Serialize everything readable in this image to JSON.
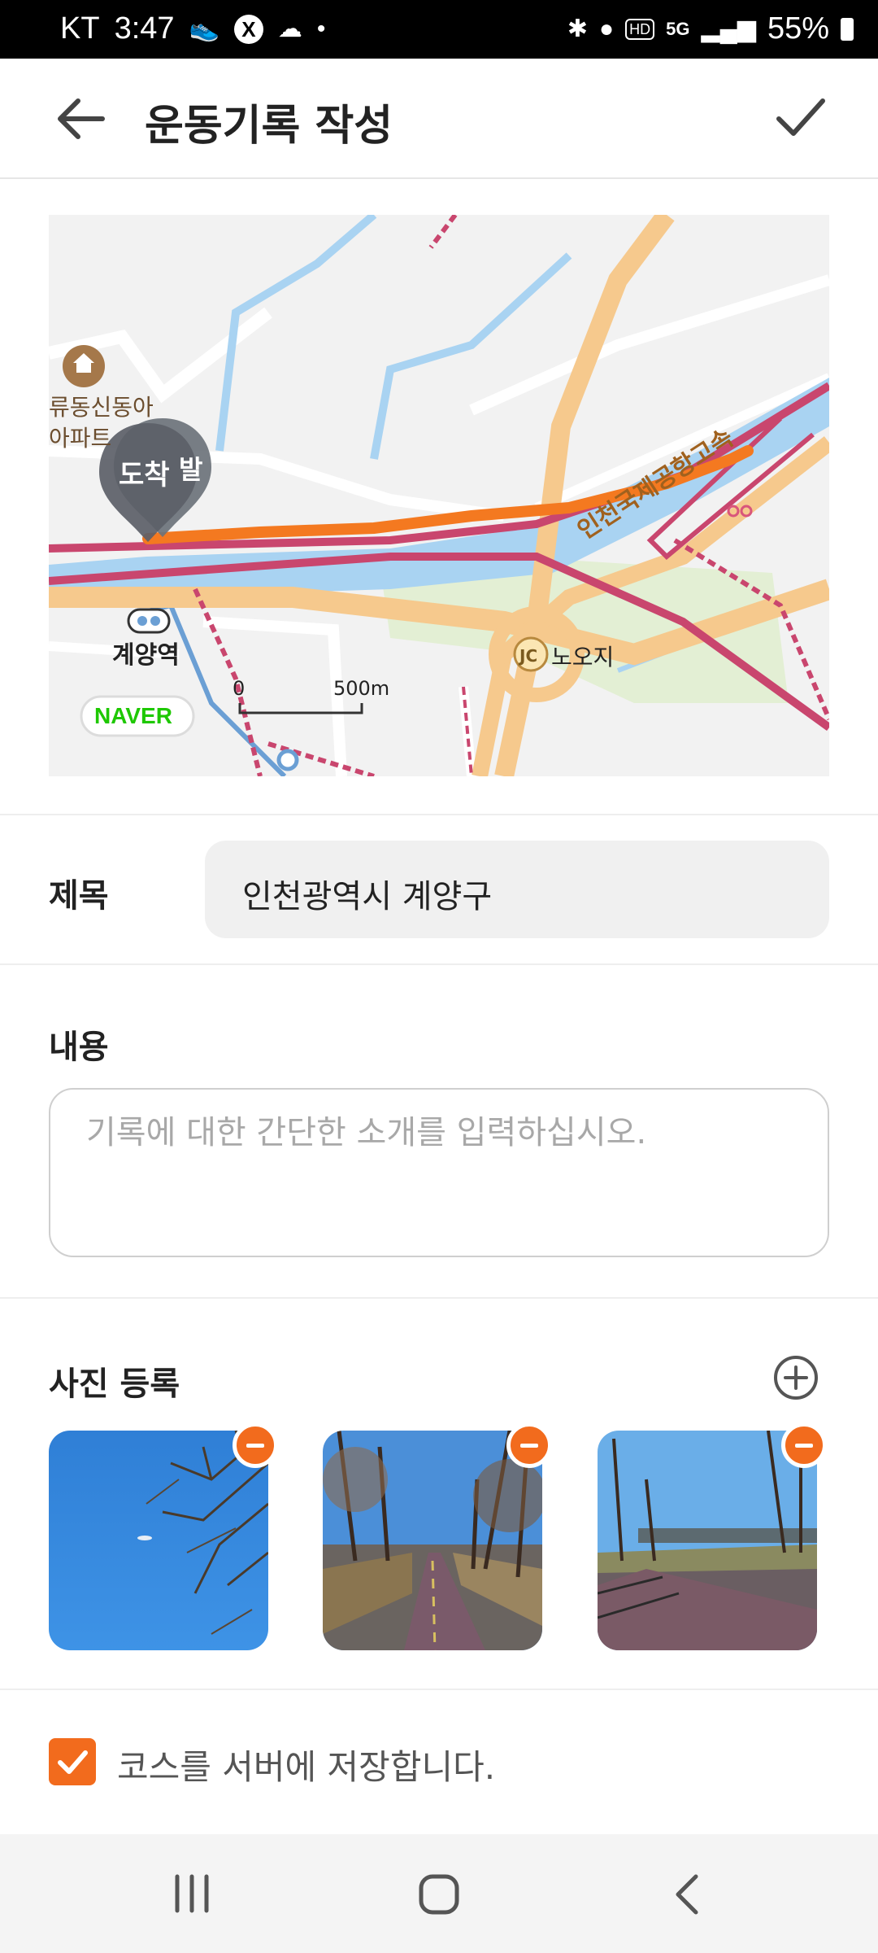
{
  "status_bar": {
    "carrier": "KT",
    "time": "3:47",
    "network": "5G",
    "battery": "55%"
  },
  "app_bar": {
    "title": "운동기록 작성",
    "back_icon": "arrow-left-icon",
    "confirm_icon": "check-icon"
  },
  "map": {
    "labels": {
      "apartment": "류동신동아\n아파트",
      "arrival_pin": "도착",
      "start_pin": "발",
      "station": "계양역",
      "brand": "NAVER",
      "scale_zero": "0",
      "scale_dist": "500m",
      "junction_badge": "JC",
      "junction_name": "노오지",
      "highway": "인천국제공항고속"
    },
    "colors": {
      "route": "#f47920",
      "water": "#a9d3f2",
      "road": "#f6c98d",
      "highway": "#c9466e",
      "park": "#e4efd5",
      "naver_green": "#1ec800"
    }
  },
  "form": {
    "title_label": "제목",
    "title_value": "인천광역시 계양구",
    "content_label": "내용",
    "content_placeholder": "기록에 대한 간단한 소개를 입력하십시오.",
    "photo_label": "사진 등록",
    "photos": [
      {
        "name": "photo-sky-branches"
      },
      {
        "name": "photo-tree-lined-path"
      },
      {
        "name": "photo-path-with-bridge"
      }
    ],
    "save_course_label": "코스를 서버에 저장합니다.",
    "save_course_checked": true
  },
  "colors": {
    "accent": "#f26b1d"
  }
}
